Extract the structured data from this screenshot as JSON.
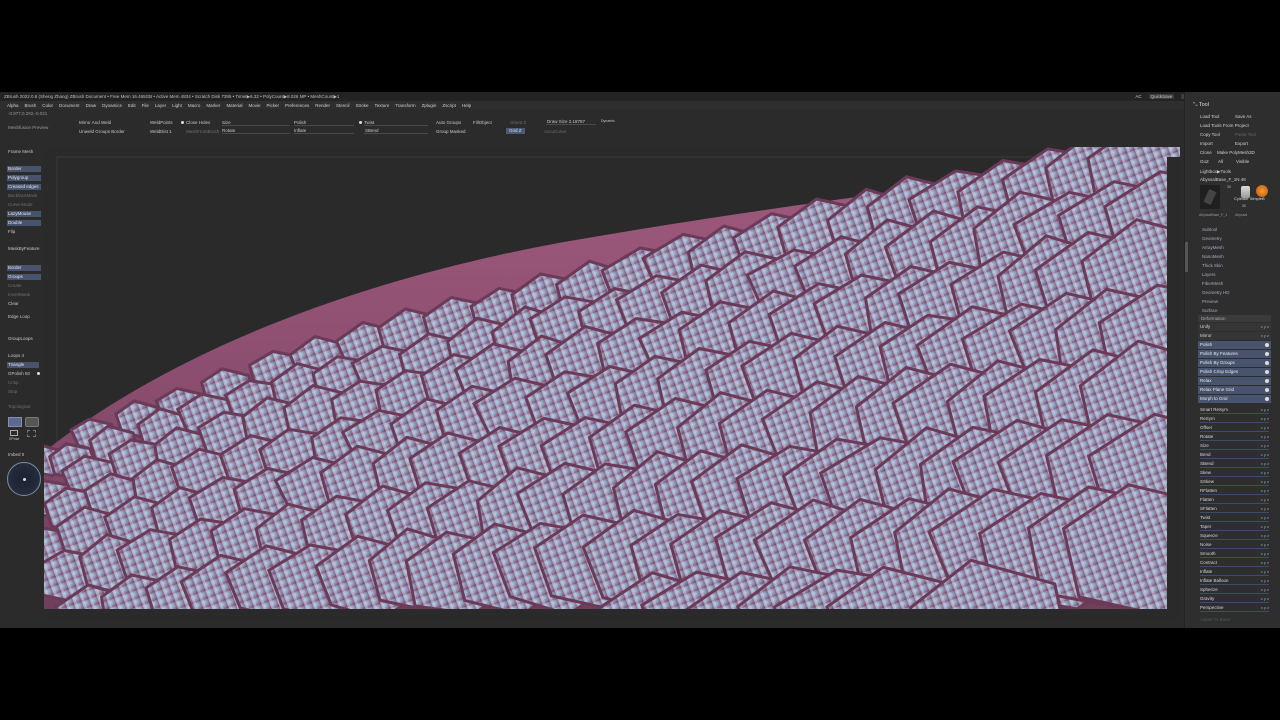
{
  "titlebar": {
    "title": "ZBrush 2022.0.8 (Sheng Zhang)   ZBrush Document     • Free Mem 16.465GB • Active Mem 4834 • Scratch Disk 7395 • Timer▶6.32 • PolyCount▶8.026 MP • MeshCount▶1",
    "ac": "AC",
    "quicksave": "QuickSave",
    "seethrough": "See-through  0",
    "menus": "Menus",
    "defaultzscript": "DefaultZScript"
  },
  "menubar": [
    "Alpha",
    "Brush",
    "Color",
    "Document",
    "Draw",
    "Dynamics",
    "Edit",
    "File",
    "Layer",
    "Light",
    "Macro",
    "Marker",
    "Material",
    "Movie",
    "Picker",
    "Preferences",
    "Render",
    "Stencil",
    "Stroke",
    "Texture",
    "Transform",
    "Zplugin",
    "Zscript",
    "Help"
  ],
  "coords": "-0.877,0.292,-0.021",
  "meshprev": "Meshfusion Preview",
  "toolbar": {
    "mirror_weld": "Mirror And Weld",
    "unweld_groups": "Unweld Groups Border",
    "weld_points": "WeldPoints",
    "weld_dist": "WeldDist 1",
    "close_holes": "Close Holes",
    "mesh_from_brush": "MeshFromBrush",
    "size": "Size",
    "rotate": "Rotate",
    "polish": "Polish",
    "inflate": "Inflate",
    "twist": "Twist",
    "sbend": "SBend",
    "auto_groups": "Auto Groups",
    "group_masked": "Group Masked",
    "fillobject": "FillObject",
    "draw_size": "Draw Size 2.18787",
    "dynamic": "Dynamic",
    "orient_z": "Orient Z",
    "grid_z": "Grid Z",
    "accucurve": "AccuCurve"
  },
  "left": {
    "frame_mesh": "Frame Mesh",
    "border": "Border",
    "polygroup": "Polygroup",
    "creased_edges": "Creased edges",
    "backface_mask": "BackfaceMask",
    "curve_mode": "Curve Mode",
    "lazy_mouse": "LazyMouse",
    "double": "Double",
    "flip": "Flip",
    "mask_by_feature": "MaskByFeature",
    "border2": "Border",
    "groups": "Groups",
    "create": "Create",
    "invert_mask": "InvertMask",
    "clear": "Clear",
    "edge_loop": "Edge Loop",
    "group_loops": "GroupLoops",
    "loops": "Loops 4",
    "triangle": "Triangle",
    "gpolish": "GPolish 50",
    "crisp": "Crisp",
    "stop": "Stop",
    "topological": "Topological",
    "xpose": "XPose",
    "imbed": "Imbed 0"
  },
  "right": {
    "tool": "Tool",
    "load_tool": "Load Tool",
    "save_as": "Save As",
    "load_from_project": "Load Tools From Project",
    "copy_tool": "Copy Tool",
    "paste_tool": "Paste Tool",
    "import": "Import",
    "export": "Export",
    "clone": "Clone",
    "make_polymesh": "Make PolyMesh3D",
    "goz": "GoZ",
    "all": "All",
    "visible": "Visible",
    "lightbox_tools": "Lightbox▶Tools",
    "current_tool": "AbyssalBase_F_1N  48",
    "thumb1_label": "AbyssalBase_F_1",
    "thumb2_label": "Cylinder SimpleB",
    "thumb3_label": "Abyssal",
    "num_30a": "30",
    "num_30b": "30",
    "sections": [
      "Subtool",
      "Geometry",
      "ArrayMesh",
      "NanoMesh",
      "Thick Skin",
      "Layers",
      "FiberMesh",
      "Geometry HD",
      "Preview",
      "Surface"
    ],
    "deformation": "Deformation",
    "deform_buttons": [
      {
        "label": "Unify",
        "keys": "x y z",
        "active": false
      },
      {
        "label": "Mirror",
        "keys": "x y z",
        "active": false
      },
      {
        "label": "Polish",
        "keys": "",
        "active": true
      },
      {
        "label": "Polish By Features",
        "keys": "",
        "active": true
      },
      {
        "label": "Polish By Groups",
        "keys": "",
        "active": true
      },
      {
        "label": "Polish Crisp Edges",
        "keys": "",
        "active": true
      },
      {
        "label": "Relax",
        "keys": "",
        "active": true
      },
      {
        "label": "Relax Plane Grid",
        "keys": "",
        "active": true
      },
      {
        "label": "Morph to Grid",
        "keys": "",
        "active": true
      }
    ],
    "deform_sliders": [
      {
        "label": "Smart ReSym",
        "keys": "x y z"
      },
      {
        "label": "ReSym",
        "keys": "x y z"
      },
      {
        "label": "Offset",
        "keys": "x y z"
      },
      {
        "label": "Rotate",
        "keys": "x y z"
      },
      {
        "label": "Size",
        "keys": "x y z"
      },
      {
        "label": "Bend",
        "keys": "x y z"
      },
      {
        "label": "SBend",
        "keys": "x y z"
      },
      {
        "label": "Skew",
        "keys": "x y z"
      },
      {
        "label": "SSkew",
        "keys": "x y z"
      },
      {
        "label": "RFlatten",
        "keys": "x y z"
      },
      {
        "label": "Flatten",
        "keys": "x y z"
      },
      {
        "label": "SFlatten",
        "keys": "x y z"
      },
      {
        "label": "Twist",
        "keys": "x y z"
      },
      {
        "label": "Taper",
        "keys": "x y z"
      },
      {
        "label": "Squeeze",
        "keys": "x y z"
      },
      {
        "label": "Noise",
        "keys": "x y z"
      },
      {
        "label": "Smooth",
        "keys": "x y z"
      },
      {
        "label": "Contract",
        "keys": "x y z"
      },
      {
        "label": "Inflate",
        "keys": "x y z"
      },
      {
        "label": "Inflate Balloon",
        "keys": "x y z"
      },
      {
        "label": "Spherize",
        "keys": "x y z"
      },
      {
        "label": "Gravity",
        "keys": "x y z"
      },
      {
        "label": "Perspective",
        "keys": "x y z"
      }
    ],
    "adjust_to_bone": "Adjust To Bone"
  },
  "colors": {
    "scale_pink": "#a0587a",
    "scale_blue": "#8a9ab8",
    "ui_bg": "#2b2b2b",
    "button_blue": "#48536e"
  }
}
